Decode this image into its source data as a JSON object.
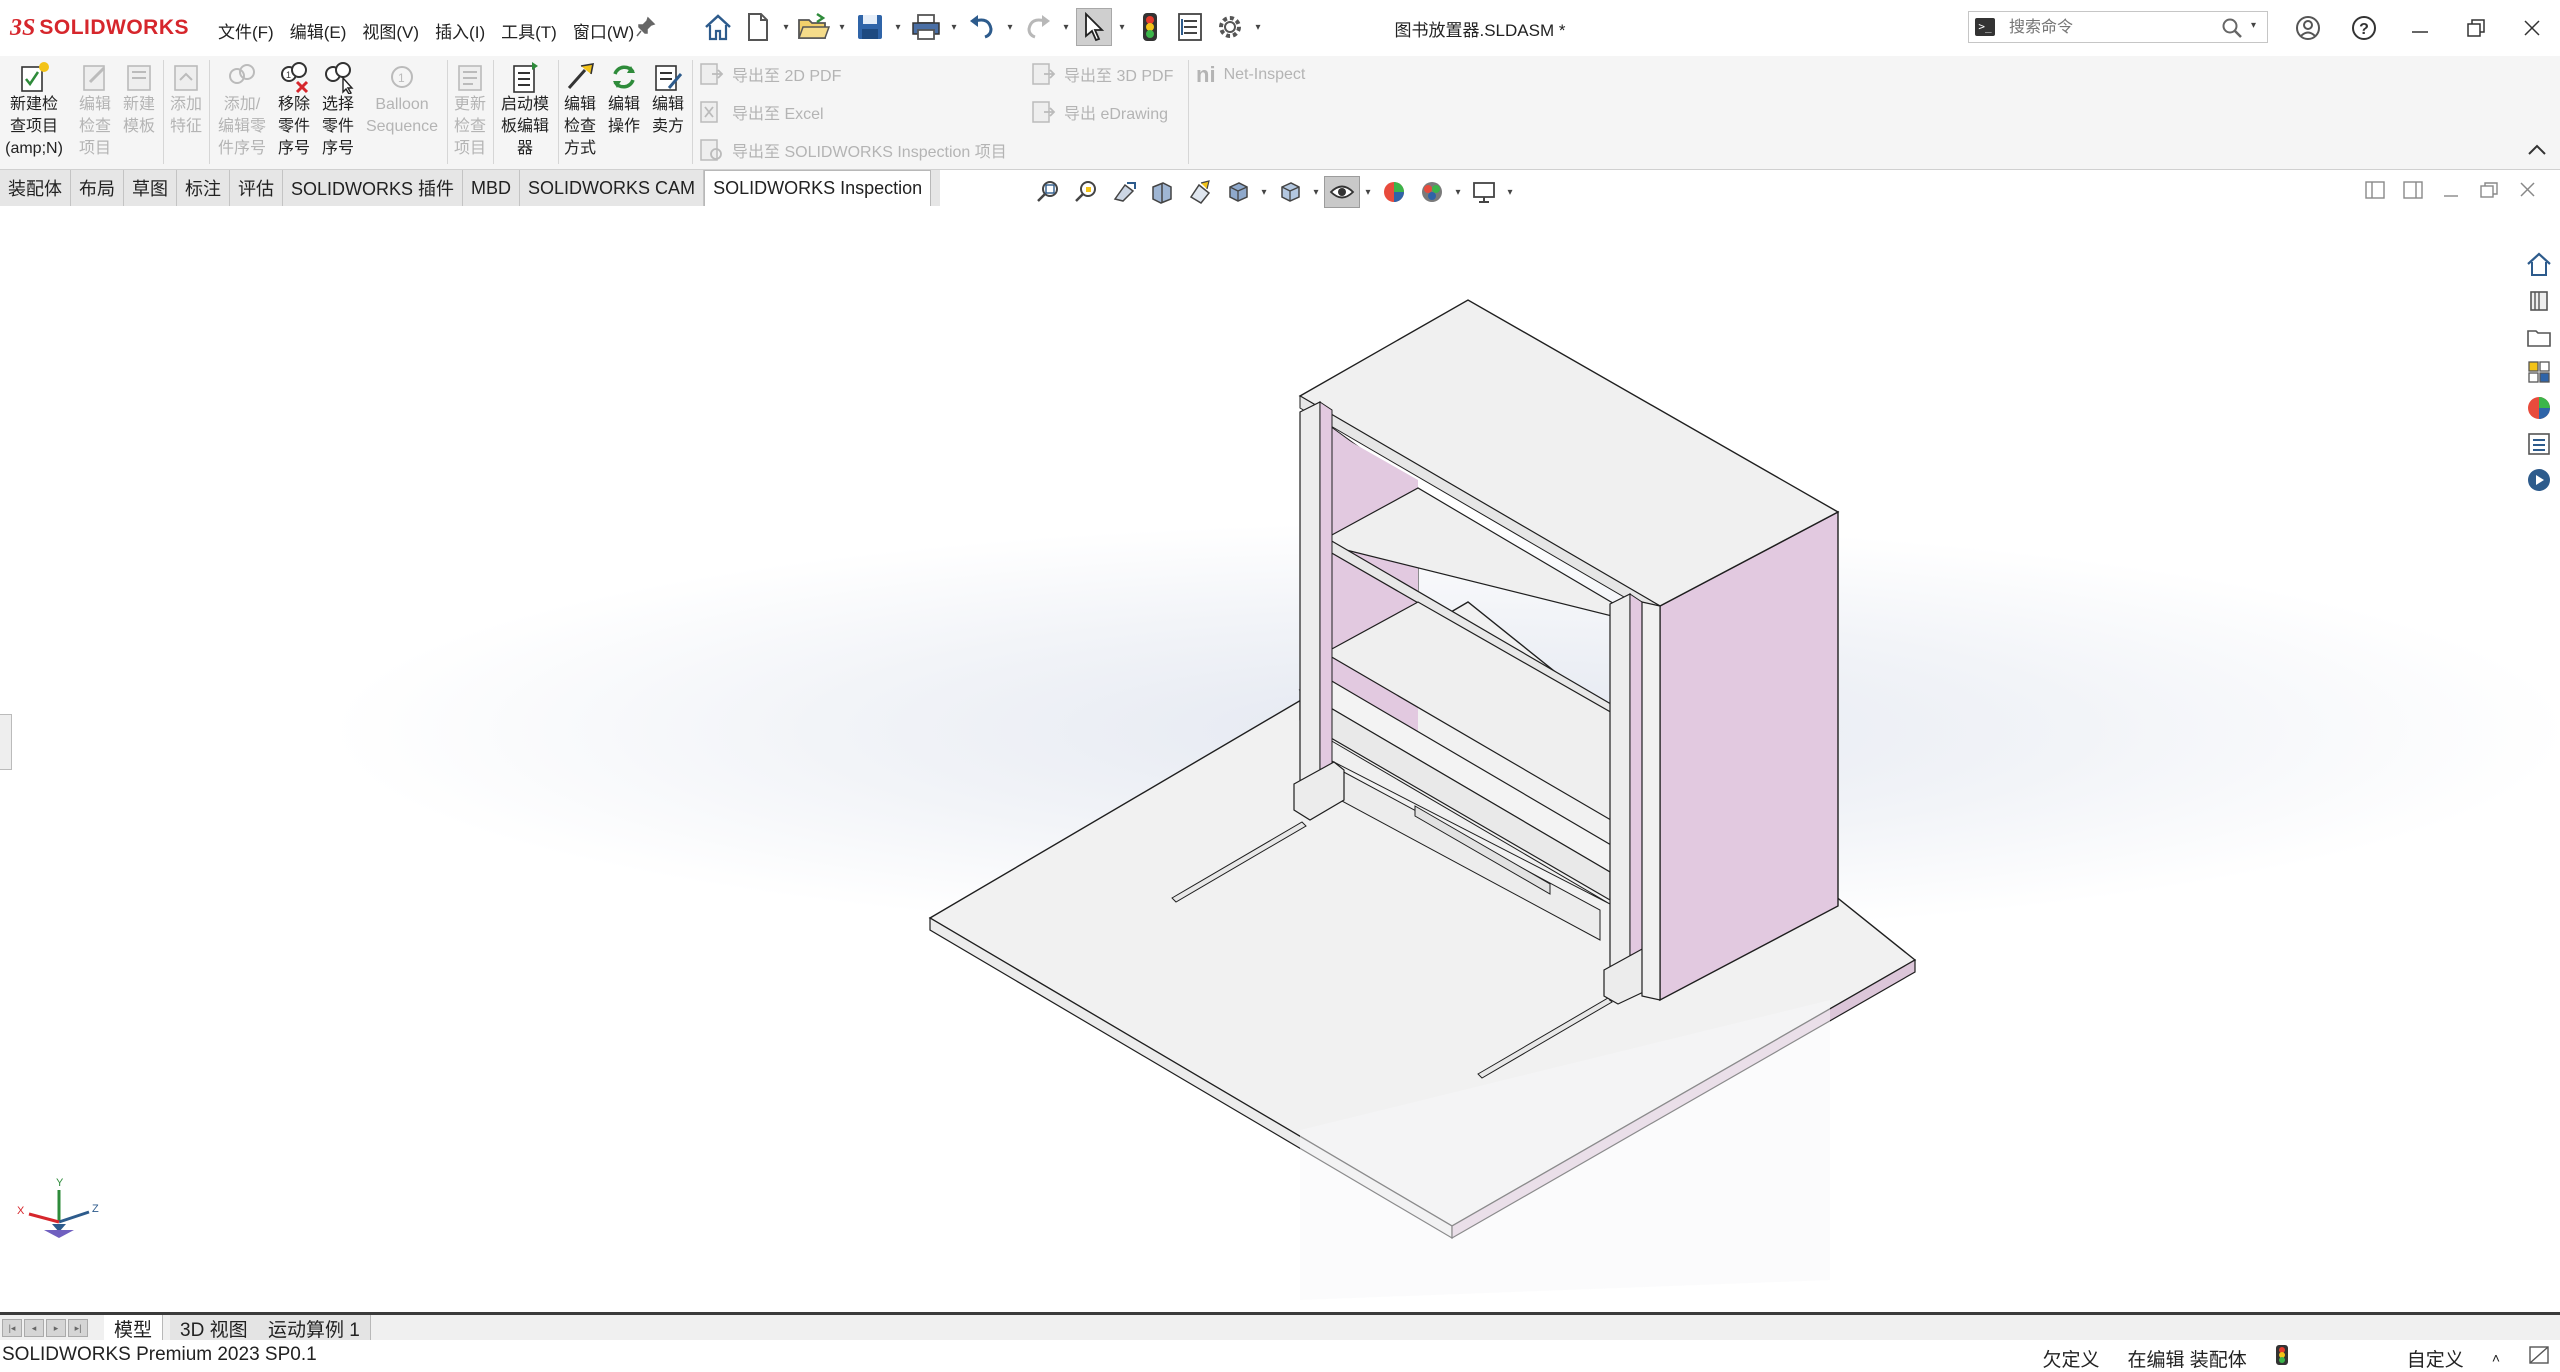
{
  "app": {
    "brand_ds": "3S",
    "brand_name": "SOLIDWORKS"
  },
  "menu": [
    "文件(F)",
    "编辑(E)",
    "视图(V)",
    "插入(I)",
    "工具(T)",
    "窗口(W)"
  ],
  "document_title": "图书放置器.SLDASM *",
  "search": {
    "placeholder": "搜索命令"
  },
  "command_manager": {
    "buttons": [
      {
        "label1": "新建检",
        "label2": "查项目",
        "label3": "(amp;N)",
        "enabled": true
      },
      {
        "label1": "编辑",
        "label2": "检查",
        "label3": "项目",
        "enabled": false
      },
      {
        "label1": "新建",
        "label2": "模板",
        "label3": "",
        "enabled": false
      },
      {
        "label1": "添加",
        "label2": "特征",
        "label3": "",
        "enabled": false
      },
      {
        "label1": "添加/",
        "label2": "编辑零",
        "label3": "件序号",
        "enabled": false
      },
      {
        "label1": "移除",
        "label2": "零件",
        "label3": "序号",
        "enabled": true
      },
      {
        "label1": "选择",
        "label2": "零件",
        "label3": "序号",
        "enabled": true
      },
      {
        "label1": "Balloon",
        "label2": "Sequence",
        "label3": "",
        "enabled": false
      },
      {
        "label1": "更新",
        "label2": "检查",
        "label3": "项目",
        "enabled": false
      },
      {
        "label1": "启动模",
        "label2": "板编辑",
        "label3": "器",
        "enabled": true
      },
      {
        "label1": "编辑",
        "label2": "检查",
        "label3": "方式",
        "enabled": true
      },
      {
        "label1": "编辑",
        "label2": "操作",
        "label3": "",
        "enabled": true
      },
      {
        "label1": "编辑",
        "label2": "卖方",
        "label3": "",
        "enabled": true
      }
    ],
    "export": [
      {
        "label": "导出至 2D PDF"
      },
      {
        "label": "导出至 Excel"
      },
      {
        "label": "导出至 SOLIDWORKS Inspection 项目"
      },
      {
        "label": "导出至 3D PDF"
      },
      {
        "label": "导出 eDrawing"
      }
    ],
    "net_inspect": "Net-Inspect"
  },
  "tabs": [
    "装配体",
    "布局",
    "草图",
    "标注",
    "评估",
    "SOLIDWORKS 插件",
    "MBD",
    "SOLIDWORKS CAM",
    "SOLIDWORKS Inspection"
  ],
  "active_tab": "SOLIDWORKS Inspection",
  "bottom_tabs": [
    "模型",
    "3D 视图",
    "运动算例 1"
  ],
  "status": {
    "left": "SOLIDWORKS Premium 2023 SP0.1",
    "definition": "欠定义",
    "editing": "在编辑 装配体",
    "units": "自定义",
    "units_caret": "˄"
  },
  "triad": {
    "x": "X",
    "y": "Y",
    "z": "Z"
  },
  "colors": {
    "brand": "#d6262c",
    "model_face": "#f0f0f0",
    "model_accent": "#e2c9e0",
    "edge": "#1f1f1f"
  }
}
